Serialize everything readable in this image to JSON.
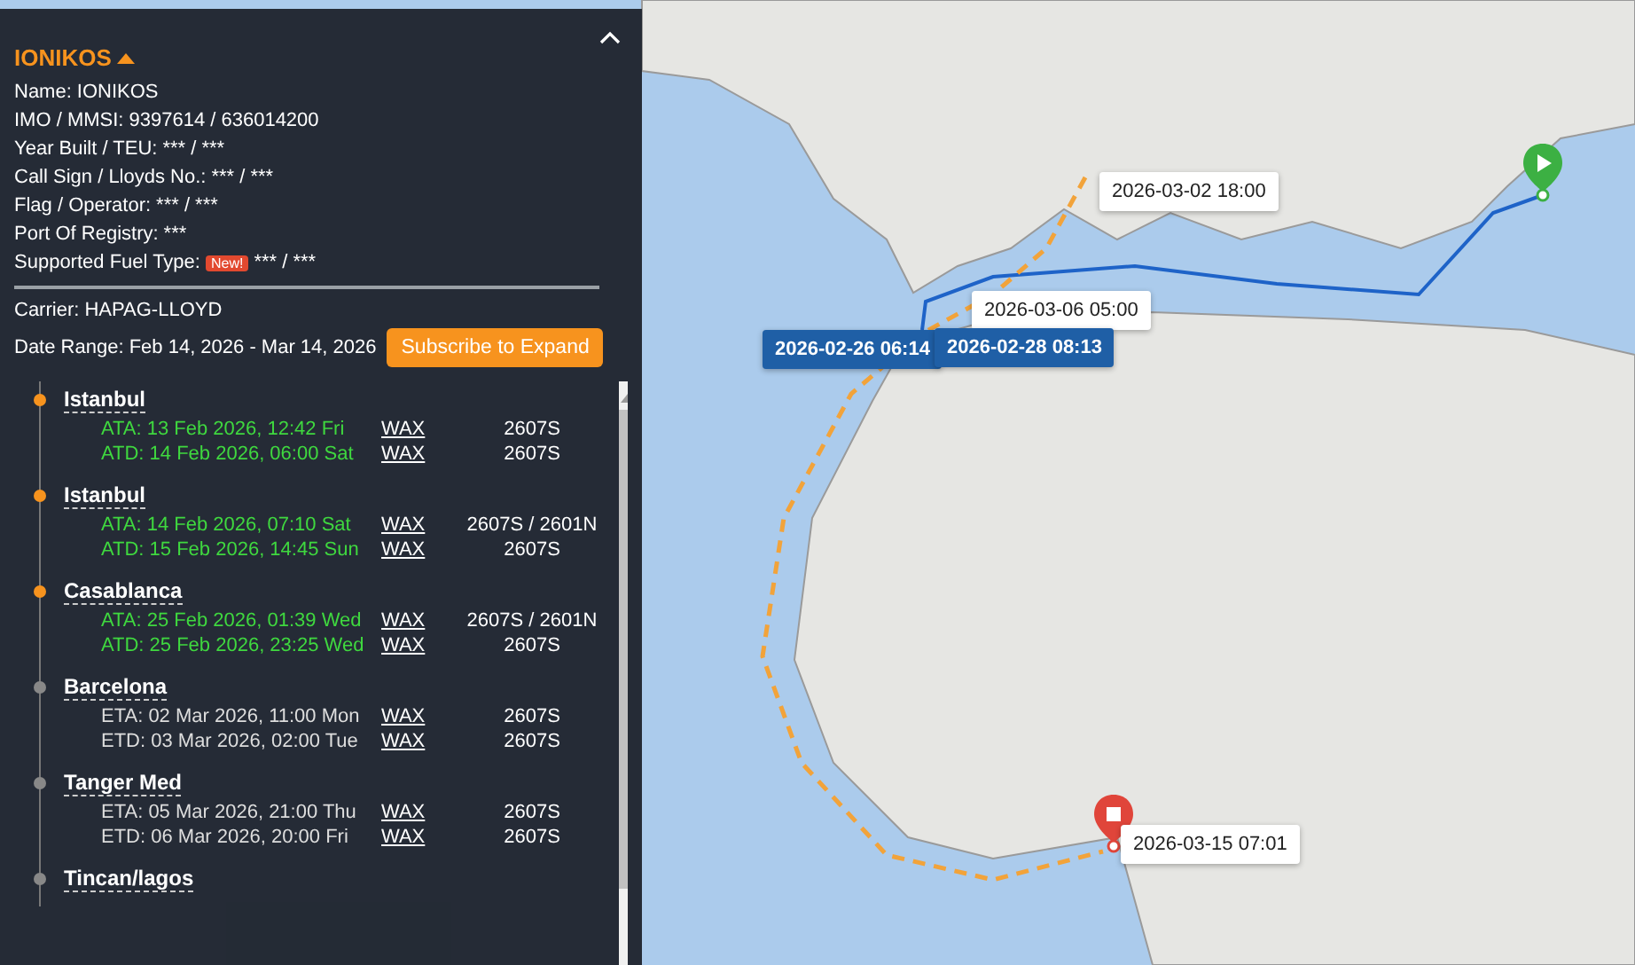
{
  "vessel": {
    "name": "IONIKOS",
    "expanded": true
  },
  "details": [
    {
      "label": "Name:",
      "value": "IONIKOS"
    },
    {
      "label": "IMO / MMSI:",
      "value": "9397614 / 636014200"
    },
    {
      "label": "Year Built / TEU:",
      "value": "*** / ***"
    },
    {
      "label": "Call Sign / Lloyds No.:",
      "value": "*** / ***"
    },
    {
      "label": "Flag / Operator:",
      "value": "*** / ***"
    },
    {
      "label": "Port Of Registry:",
      "value": "***"
    },
    {
      "label": "Supported Fuel Type:",
      "badge": "New!",
      "value": "*** / ***"
    }
  ],
  "carrier": "Carrier: HAPAG-LLOYD",
  "date_range": "Date Range: Feb 14, 2026 - Mar 14, 2026",
  "subscribe_button": "Subscribe to Expand",
  "ports": [
    {
      "port": "Istanbul",
      "reached": true,
      "events": [
        {
          "time": "ATA: 13 Feb 2026, 12:42 Fri",
          "service": "WAX",
          "voyage": "2607S"
        },
        {
          "time": "ATD: 14 Feb 2026, 06:00 Sat",
          "service": "WAX",
          "voyage": "2607S"
        }
      ]
    },
    {
      "port": "Istanbul",
      "reached": true,
      "events": [
        {
          "time": "ATA: 14 Feb 2026, 07:10 Sat",
          "service": "WAX",
          "voyage": "2607S / 2601N"
        },
        {
          "time": "ATD: 15 Feb 2026, 14:45 Sun",
          "service": "WAX",
          "voyage": "2607S"
        }
      ]
    },
    {
      "port": "Casablanca",
      "reached": true,
      "events": [
        {
          "time": "ATA: 25 Feb 2026, 01:39 Wed",
          "service": "WAX",
          "voyage": "2607S / 2601N"
        },
        {
          "time": "ATD: 25 Feb 2026, 23:25 Wed",
          "service": "WAX",
          "voyage": "2607S"
        }
      ]
    },
    {
      "port": "Barcelona",
      "reached": false,
      "events": [
        {
          "time": "ETA: 02 Mar 2026, 11:00 Mon",
          "service": "WAX",
          "voyage": "2607S"
        },
        {
          "time": "ETD: 03 Mar 2026, 02:00 Tue",
          "service": "WAX",
          "voyage": "2607S"
        }
      ]
    },
    {
      "port": "Tanger Med",
      "reached": false,
      "events": [
        {
          "time": "ETA: 05 Mar 2026, 21:00 Thu",
          "service": "WAX",
          "voyage": "2607S"
        },
        {
          "time": "ETD: 06 Mar 2026, 20:00 Fri",
          "service": "WAX",
          "voyage": "2607S"
        }
      ]
    },
    {
      "port": "Tincan/lagos",
      "reached": false
    }
  ],
  "map": {
    "labels": [
      {
        "text": "2026-03-02 18:00",
        "kind": "plain"
      },
      {
        "text": "2026-03-06 05:00",
        "kind": "plain"
      },
      {
        "text": "2026-02-26 06:14",
        "kind": "highlight"
      },
      {
        "text": "2026-02-28 08:13",
        "kind": "highlight"
      },
      {
        "text": "2026-03-15 07:01",
        "kind": "plain"
      }
    ],
    "markers": [
      {
        "kind": "origin"
      },
      {
        "kind": "destination"
      }
    ]
  }
}
